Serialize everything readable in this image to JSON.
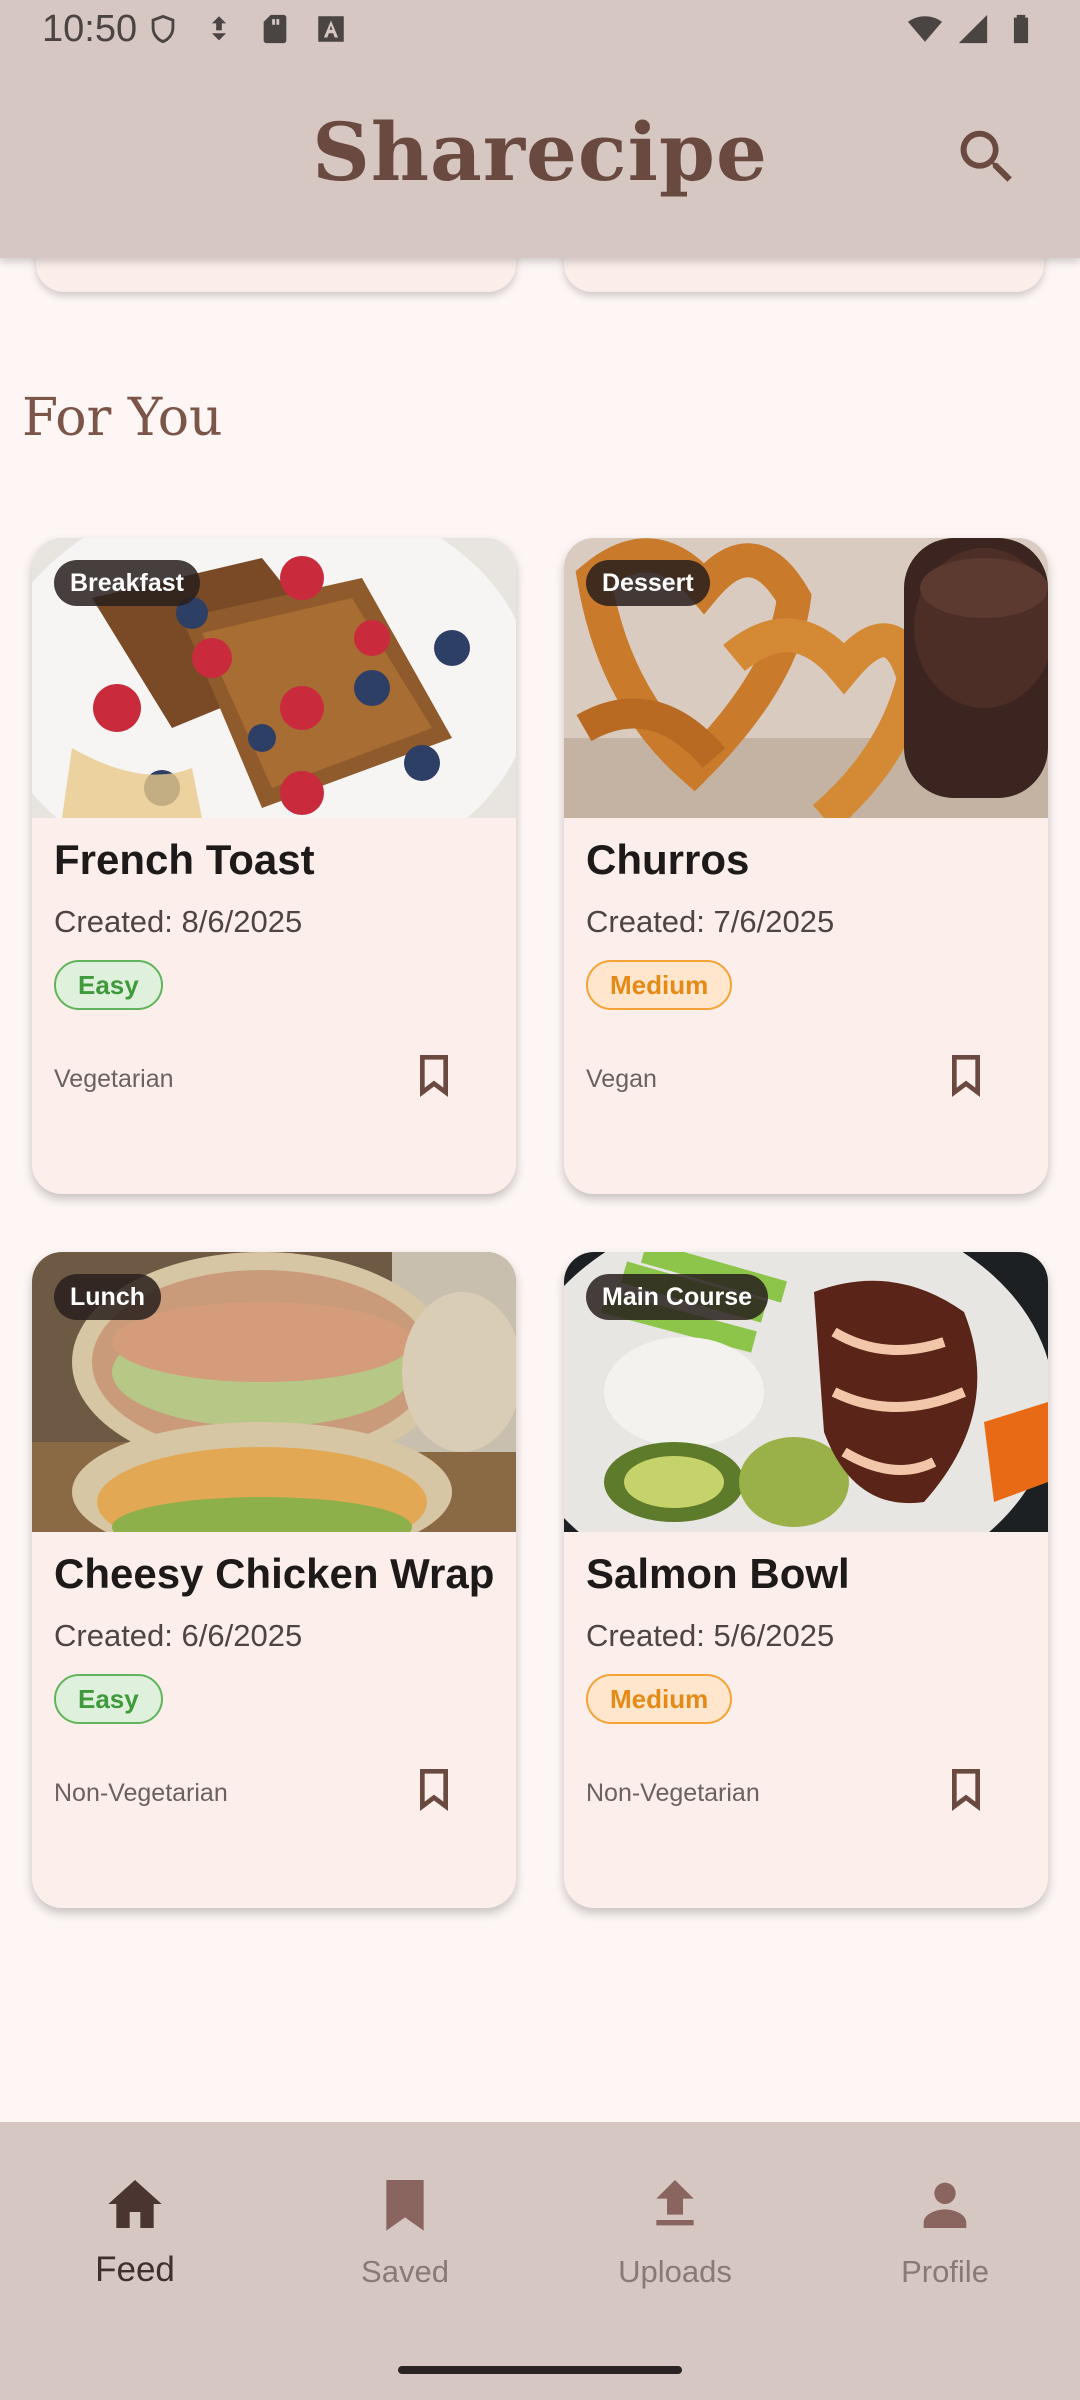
{
  "status_bar": {
    "time": "10:50",
    "left_icons": [
      "shield-icon",
      "download-arrow-icon",
      "sd-card-icon",
      "font-a-icon"
    ],
    "right_icons": [
      "wifi-icon",
      "signal-icon",
      "battery-icon"
    ]
  },
  "app_bar": {
    "title": "Sharecipe",
    "search_icon": "search-icon"
  },
  "section": {
    "title": "For You"
  },
  "recipes": [
    {
      "category": "Breakfast",
      "title": "French Toast",
      "created": "Created: 8/6/2025",
      "difficulty": "Easy",
      "diet": "Vegetarian",
      "saved": false
    },
    {
      "category": "Dessert",
      "title": "Churros",
      "created": "Created: 7/6/2025",
      "difficulty": "Medium",
      "diet": "Vegan",
      "saved": false
    },
    {
      "category": "Lunch",
      "title": "Cheesy Chicken Wrap",
      "created": "Created: 6/6/2025",
      "difficulty": "Easy",
      "diet": "Non-Vegetarian",
      "saved": false
    },
    {
      "category": "Main Course",
      "title": "Salmon Bowl",
      "created": "Created: 5/6/2025",
      "difficulty": "Medium",
      "diet": "Non-Vegetarian",
      "saved": false
    }
  ],
  "bottom_nav": {
    "items": [
      {
        "label": "Feed",
        "icon": "home-icon",
        "active": true
      },
      {
        "label": "Saved",
        "icon": "bookmark-icon",
        "active": false
      },
      {
        "label": "Uploads",
        "icon": "upload-icon",
        "active": false
      },
      {
        "label": "Profile",
        "icon": "person-icon",
        "active": false
      }
    ]
  },
  "colors": {
    "app_bar": "#d6c7c3",
    "brand_text": "#6a4a40",
    "background": "#fdf6f4",
    "card": "#fcefeb",
    "easy": "#3f9a3c",
    "medium": "#e58a16"
  }
}
